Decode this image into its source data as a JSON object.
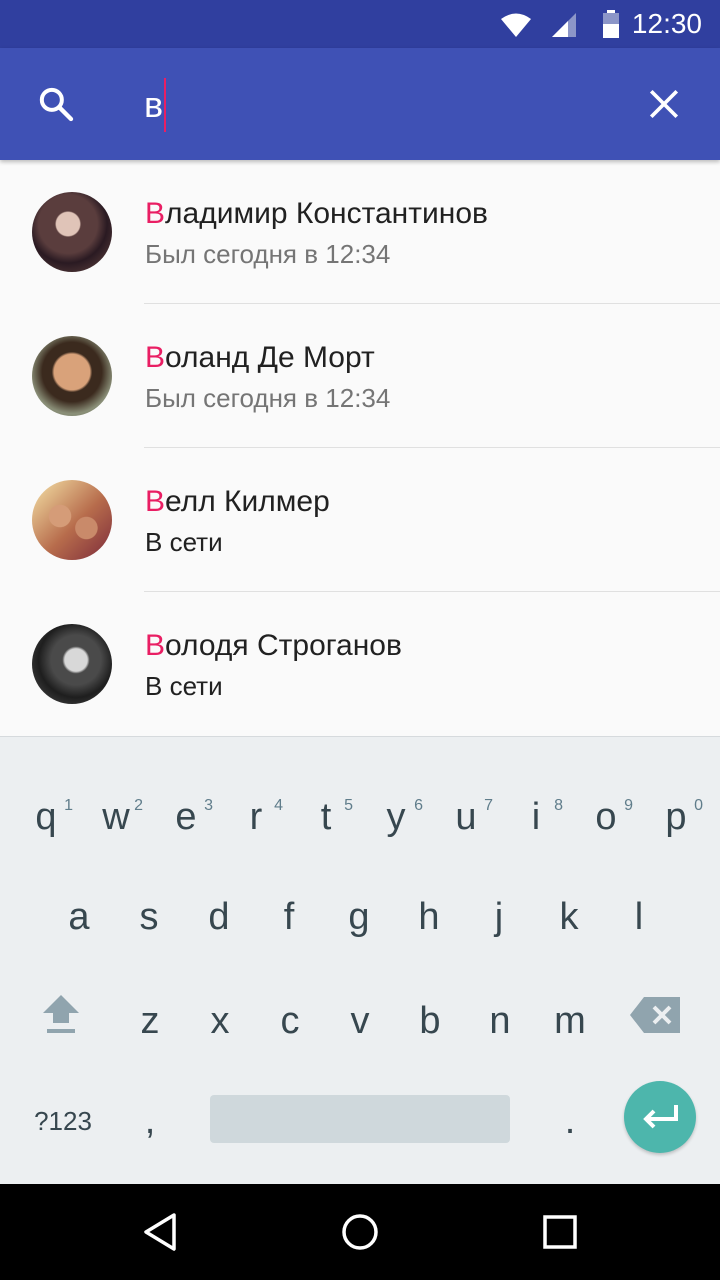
{
  "status_bar": {
    "time": "12:30",
    "icons": [
      "wifi-icon",
      "signal-icon",
      "battery-icon"
    ]
  },
  "search": {
    "query": "в",
    "icon": "search-icon",
    "close_icon": "close-icon"
  },
  "colors": {
    "primary": "#3f51b5",
    "primary_dark": "#303f9f",
    "accent": "#e91e63",
    "enter_key": "#4db6ac"
  },
  "contacts": [
    {
      "name_match": "В",
      "name_rest": "ладимир Константинов",
      "status": "Был сегодня в 12:34",
      "online": false
    },
    {
      "name_match": "В",
      "name_rest": "оланд Де Морт",
      "status": "Был сегодня в 12:34",
      "online": false
    },
    {
      "name_match": "В",
      "name_rest": "елл Килмер",
      "status": "В сети",
      "online": true
    },
    {
      "name_match": "В",
      "name_rest": "олодя Строганов",
      "status": "В сети",
      "online": true
    }
  ],
  "keyboard": {
    "row1": [
      {
        "key": "q",
        "hint": "1"
      },
      {
        "key": "w",
        "hint": "2"
      },
      {
        "key": "e",
        "hint": "3"
      },
      {
        "key": "r",
        "hint": "4"
      },
      {
        "key": "t",
        "hint": "5"
      },
      {
        "key": "y",
        "hint": "6"
      },
      {
        "key": "u",
        "hint": "7"
      },
      {
        "key": "i",
        "hint": "8"
      },
      {
        "key": "o",
        "hint": "9"
      },
      {
        "key": "p",
        "hint": "0"
      }
    ],
    "row2": [
      "a",
      "s",
      "d",
      "f",
      "g",
      "h",
      "j",
      "k",
      "l"
    ],
    "row3": [
      "z",
      "x",
      "c",
      "v",
      "b",
      "n",
      "m"
    ],
    "symbols_label": "?123",
    "comma": ",",
    "period": "."
  },
  "nav": [
    "back-icon",
    "home-icon",
    "recents-icon"
  ]
}
